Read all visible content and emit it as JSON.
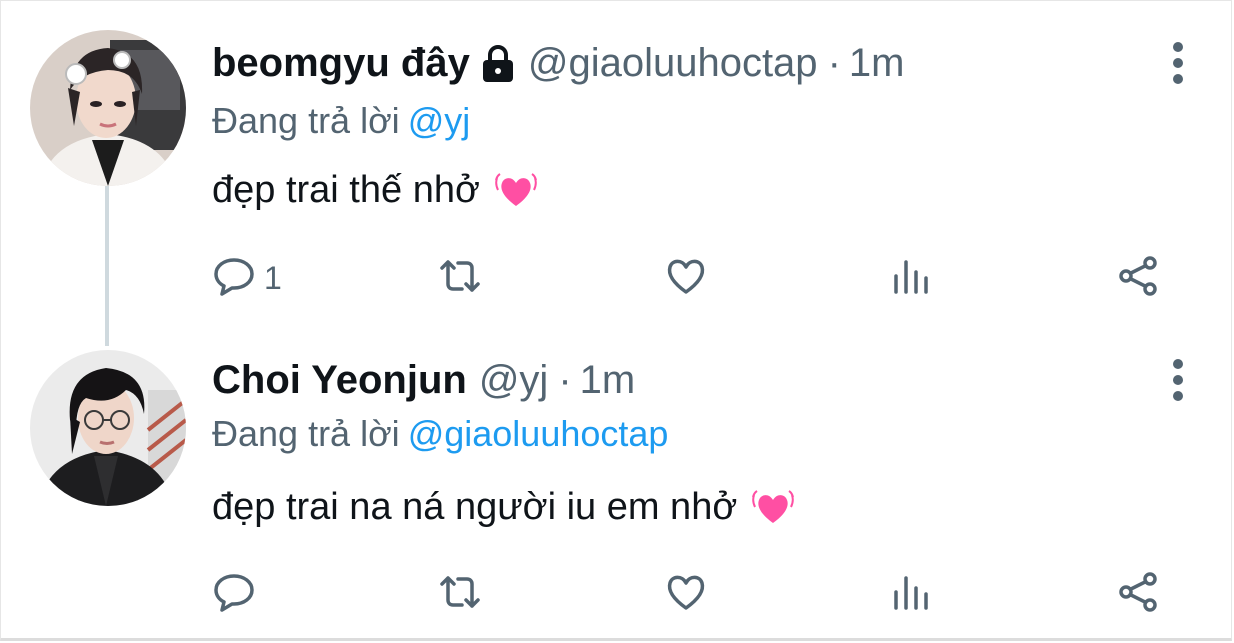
{
  "tweets": [
    {
      "display_name": "beomgyu đây",
      "handle": "@giaoluuhoctap",
      "separator": "·",
      "time": "1m",
      "replying_prefix": "Đang trả lời",
      "replying_to": "@yj",
      "text": "đẹp trai thế nhở",
      "reply_count": "1",
      "protected": true
    },
    {
      "display_name": "Choi Yeonjun",
      "handle": "@yj",
      "separator": "·",
      "time": "1m",
      "replying_prefix": "Đang trả lời",
      "replying_to": "@giaoluuhoctap",
      "text": "đẹp trai na ná người iu em nhở",
      "reply_count": "",
      "protected": false
    }
  ],
  "icons": {
    "more": "more-vertical-icon",
    "lock": "lock-icon",
    "reply": "reply-icon",
    "retweet": "retweet-icon",
    "like": "like-heart-icon",
    "analytics": "analytics-icon",
    "share": "share-icon",
    "emoji": "pink-heart-emoji"
  },
  "colors": {
    "text": "#0f1419",
    "secondary": "#536471",
    "mention": "#1d9bf0",
    "thread_line": "#cfd9de",
    "heart_emoji": "#ff4fa3"
  }
}
